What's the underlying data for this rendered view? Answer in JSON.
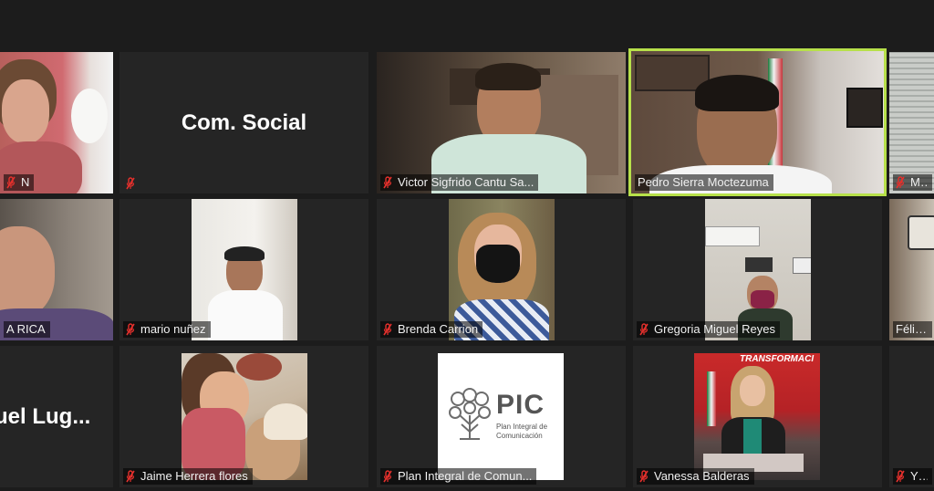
{
  "colors": {
    "active_speaker": "#b7e04a",
    "muted_icon": "#e5302c",
    "tile_bg": "#252525"
  },
  "tiles": [
    {
      "name": "N",
      "muted": true
    },
    {
      "name": "",
      "display_text": "Com. Social",
      "muted": true
    },
    {
      "name": "Victor Sigfrido Cantu Sa...",
      "muted": true
    },
    {
      "name": "Pedro Sierra Moctezuma",
      "muted": false,
      "active_speaker": true
    },
    {
      "name": "Mar",
      "muted": true
    },
    {
      "name": "A RICA",
      "muted": false
    },
    {
      "name": "mario nuñez",
      "muted": true
    },
    {
      "name": "Brenda Carrion",
      "muted": true
    },
    {
      "name": "Gregoria Miguel Reyes",
      "muted": true
    },
    {
      "name": "Félix Ga",
      "muted": false
    },
    {
      "name": "",
      "display_text": "uel Lug...",
      "muted": false
    },
    {
      "name": "Jaime Herrera flores",
      "muted": true
    },
    {
      "name": "Plan Integral de Comun...",
      "muted": true
    },
    {
      "name": "Vanessa Balderas",
      "muted": true
    },
    {
      "name": "Yhe",
      "muted": true
    }
  ],
  "pic_logo": {
    "title": "PIC",
    "subtitle_line1": "Plan Integral de",
    "subtitle_line2": "Comunicación"
  },
  "background_banner": {
    "text": "TRANSFORMACI"
  }
}
